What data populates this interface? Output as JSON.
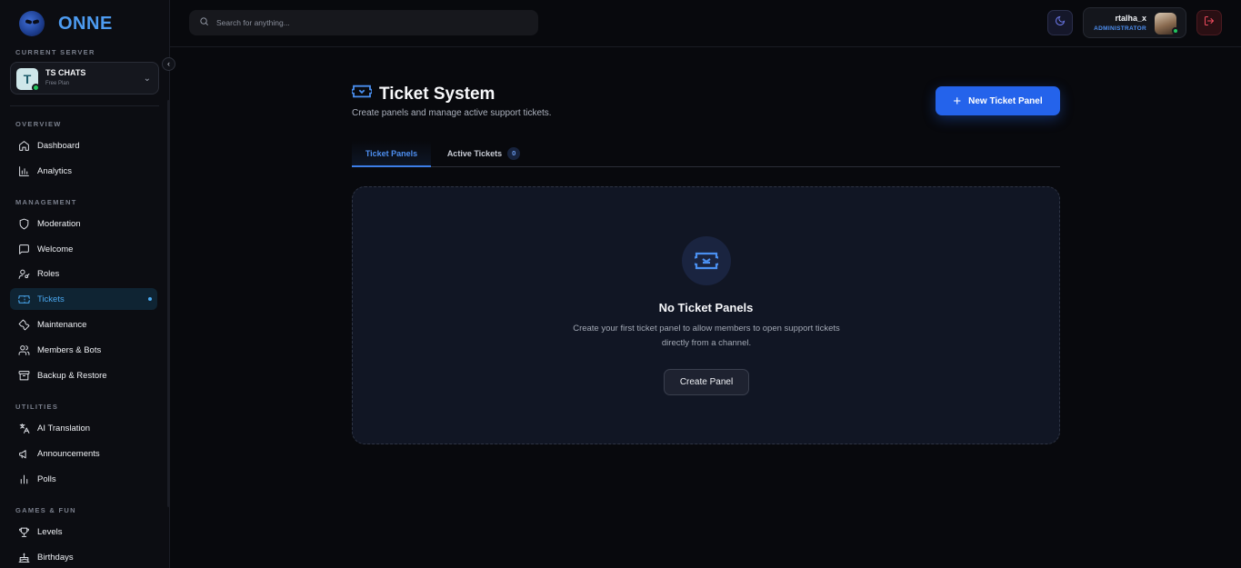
{
  "brand": {
    "name": "ONNE"
  },
  "sidebar": {
    "current_server_label": "CURRENT SERVER",
    "server": {
      "avatar_glyph": "T",
      "name": "TS CHATS",
      "plan": "Free Plan"
    },
    "sections": [
      {
        "label": "OVERVIEW"
      },
      {
        "label": "MANAGEMENT"
      },
      {
        "label": "UTILITIES"
      },
      {
        "label": "GAMES & FUN"
      }
    ],
    "items": [
      {
        "label": "Dashboard",
        "icon": "home-icon"
      },
      {
        "label": "Analytics",
        "icon": "bar-chart-icon"
      },
      {
        "label": "Moderation",
        "icon": "shield-icon"
      },
      {
        "label": "Welcome",
        "icon": "message-square-icon"
      },
      {
        "label": "Roles",
        "icon": "user-key-icon"
      },
      {
        "label": "Tickets",
        "icon": "ticket-icon",
        "active": true
      },
      {
        "label": "Maintenance",
        "icon": "wrench-icon"
      },
      {
        "label": "Members & Bots",
        "icon": "users-icon"
      },
      {
        "label": "Backup & Restore",
        "icon": "archive-icon"
      },
      {
        "label": "AI Translation",
        "icon": "languages-icon"
      },
      {
        "label": "Announcements",
        "icon": "megaphone-icon"
      },
      {
        "label": "Polls",
        "icon": "poll-icon"
      },
      {
        "label": "Levels",
        "icon": "trophy-icon"
      },
      {
        "label": "Birthdays",
        "icon": "cake-icon"
      }
    ]
  },
  "topbar": {
    "search_placeholder": "Search for anything...",
    "user": {
      "name": "rtalha_x",
      "role": "ADMINISTRATOR"
    }
  },
  "main": {
    "title": "Ticket System",
    "subtitle": "Create panels and manage active support tickets.",
    "new_button": {
      "icon": "plus-icon",
      "label": "New Ticket Panel"
    },
    "tabs": [
      {
        "label": "Ticket Panels",
        "active": true
      },
      {
        "label": "Active Tickets",
        "badge": "0"
      }
    ],
    "empty": {
      "title": "No Ticket Panels",
      "description": "Create your first ticket panel to allow members to open support tickets directly from a channel.",
      "button": "Create Panel"
    }
  },
  "colors": {
    "accent": "#2463eb",
    "active_nav": "#4aa8f0",
    "online": "#22c55e",
    "logout": "#ef4b5e"
  }
}
